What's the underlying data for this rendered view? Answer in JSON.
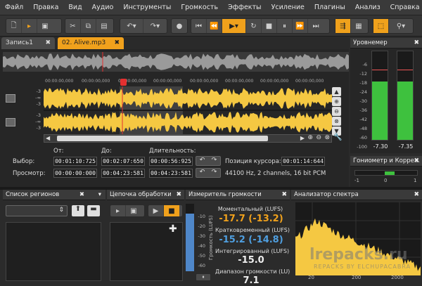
{
  "menu": [
    "Файл",
    "Правка",
    "Вид",
    "Аудио",
    "Инструменты",
    "Громкость",
    "Эффекты",
    "Усиление",
    "Плагины",
    "Анализ",
    "Справка"
  ],
  "tabs": [
    {
      "label": "Запись1"
    },
    {
      "label": "02. Alive.mp3"
    }
  ],
  "ruler": {
    "t1": "00:00:00,000",
    "t2": "00:00:00,000",
    "t3": "00:00:00,000",
    "t4": "00:00:00,000",
    "t5": "00:00:00,000",
    "t6": "00:00:00,000",
    "t7": "00:00:00,000",
    "t8": "00:00:00,000"
  },
  "db_scale": {
    "a": "-3",
    "b": "-∞",
    "c": "-3"
  },
  "selection": {
    "from_label": "От:",
    "to_label": "До:",
    "len_label": "Длительность:",
    "sel_label": "Выбор:",
    "view_label": "Просмотр:",
    "sel_from": "00:01:10:725",
    "sel_to": "00:02:07:650",
    "sel_len": "00:00:56:925",
    "view_from": "00:00:00:000",
    "view_to": "00:04:23:581",
    "view_len": "00:04:23:581",
    "cursor_label": "Позиция курсора:",
    "cursor_value": "00:01:14:644",
    "format": "44100 Hz, 2 channels, 16 bit PCM"
  },
  "level_meter": {
    "title": "Уровнемер",
    "ticks": [
      "-6",
      "-12",
      "-18",
      "-24",
      "-30",
      "-36",
      "-42",
      "-48",
      "-60",
      "-100"
    ],
    "left_value": "-7.30",
    "right_value": "-7.35",
    "left_level": 0.66,
    "right_level": 0.66
  },
  "goniometer": {
    "title": "Гониометр и Корре...",
    "min": "-1",
    "mid": "0",
    "max": "1"
  },
  "regions": {
    "title": "Список регионов"
  },
  "chain": {
    "title": "Цепочка обработки"
  },
  "loudness": {
    "title": "Измеритель громкости",
    "axis_label": "Громкость (LUFS)",
    "ticks": [
      "-10",
      "-20",
      "-30",
      "-40",
      "-50",
      "-60"
    ],
    "momentary_label": "Моментальный (LUFS)",
    "momentary_value": "-17.7 (-13.2)",
    "short_label": "Кратковременный (LUFS)",
    "short_value": "-15.2 (-14.8)",
    "integrated_label": "Интегрированный (LUFS)",
    "integrated_value": "-15.0",
    "range_label": "Диапазон громкости (LU)",
    "range_value": "7.1"
  },
  "spectrum": {
    "title": "Анализатор спектра",
    "x_ticks": [
      "20",
      "200",
      "2000"
    ]
  },
  "watermark": {
    "line1": "lrepacks.ru",
    "line2": "REPACKS BY ELCHUPACABRA"
  },
  "colors": {
    "accent": "#f0a11c",
    "wave": "#f5c842",
    "meter": "#3ec13e"
  }
}
